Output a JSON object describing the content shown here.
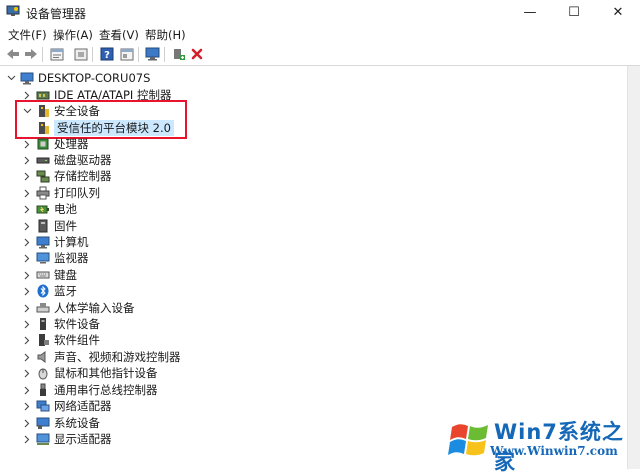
{
  "window": {
    "title": "设备管理器",
    "minimize": "—",
    "maximize": "☐",
    "close": "✕"
  },
  "menu": [
    "文件(F)",
    "操作(A)",
    "查看(V)",
    "帮助(H)"
  ],
  "toolbar": [
    "back-icon",
    "forward-icon",
    "properties-icon",
    "update-driver-icon",
    "help-icon",
    "view-icon",
    "scan-icon",
    "enable-device-icon",
    "uninstall-icon"
  ],
  "tree": {
    "root": "DESKTOP-CORU07S",
    "items": [
      {
        "label": "IDE ATA/ATAPI 控制器",
        "icon": "ide-icon"
      },
      {
        "label": "安全设备",
        "icon": "security-device-icon",
        "expanded": true,
        "children": [
          {
            "label": "受信任的平台模块 2.0",
            "icon": "tpm-icon"
          }
        ]
      },
      {
        "label": "处理器",
        "icon": "processor-icon"
      },
      {
        "label": "磁盘驱动器",
        "icon": "disk-icon"
      },
      {
        "label": "存储控制器",
        "icon": "storage-icon"
      },
      {
        "label": "打印队列",
        "icon": "printer-icon"
      },
      {
        "label": "电池",
        "icon": "battery-icon"
      },
      {
        "label": "固件",
        "icon": "firmware-icon"
      },
      {
        "label": "计算机",
        "icon": "computer-icon"
      },
      {
        "label": "监视器",
        "icon": "monitor-icon"
      },
      {
        "label": "键盘",
        "icon": "keyboard-icon"
      },
      {
        "label": "蓝牙",
        "icon": "bluetooth-icon"
      },
      {
        "label": "人体学输入设备",
        "icon": "hid-icon"
      },
      {
        "label": "软件设备",
        "icon": "software-device-icon"
      },
      {
        "label": "软件组件",
        "icon": "software-component-icon"
      },
      {
        "label": "声音、视频和游戏控制器",
        "icon": "sound-icon"
      },
      {
        "label": "鼠标和其他指针设备",
        "icon": "mouse-icon"
      },
      {
        "label": "通用串行总线控制器",
        "icon": "usb-icon"
      },
      {
        "label": "网络适配器",
        "icon": "network-icon"
      },
      {
        "label": "系统设备",
        "icon": "system-icon"
      },
      {
        "label": "显示适配器",
        "icon": "display-adapter-icon"
      }
    ]
  },
  "watermark": {
    "brand": "Win7系统之家",
    "url": "Www.Winwin7.com"
  },
  "colors": {
    "highlight_border": "#e8132c",
    "selection": "#cce8ff",
    "brand_blue": "#1568b8"
  }
}
